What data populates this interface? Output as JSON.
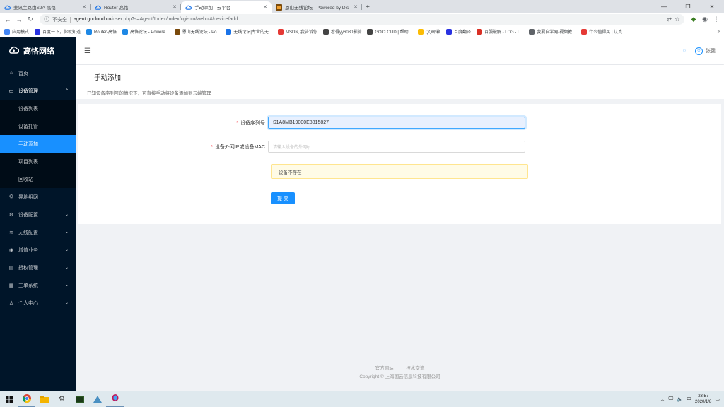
{
  "browser": {
    "tabs": [
      {
        "title": "斐讯主路由S2A-高恪",
        "active": false
      },
      {
        "title": "Router-高恪",
        "active": false
      },
      {
        "title": "手动添加 - 云平台",
        "active": true
      },
      {
        "title": "恩山无线论坛 - Powered by Dis",
        "active": false
      }
    ],
    "new_tab": "+",
    "insecure_label": "不安全",
    "url_host": "agent.gocloud.cn",
    "url_path": "/user.php?s=Agent/Index/index/cgi-bin/webui#/device/add",
    "bookmarks": [
      {
        "label": "应用模式",
        "color": "#4285f4"
      },
      {
        "label": "百度一下，你就知道",
        "color": "#2932e1"
      },
      {
        "label": "Router-高恪",
        "color": "#1e88e5"
      },
      {
        "label": "高恪论坛 - Powere...",
        "color": "#1e88e5"
      },
      {
        "label": "恩山无线论坛 - Po...",
        "color": "#7a4a0c"
      },
      {
        "label": "无线论坛|专业的无...",
        "color": "#1a73e8"
      },
      {
        "label": "MSDN, 我告诉你",
        "color": "#e53935"
      },
      {
        "label": "看得yy6080影院",
        "color": "#444444"
      },
      {
        "label": "GOCLOUD | 帮助...",
        "color": "#444444"
      },
      {
        "label": "QQ邮箱",
        "color": "#fbbc05"
      },
      {
        "label": "百度翻译",
        "color": "#2932e1"
      },
      {
        "label": "百服破解 - LCG - L...",
        "color": "#d93025"
      },
      {
        "label": "我要自学网-视频教...",
        "color": "#5f6368"
      },
      {
        "label": "什么值得买 | 认真...",
        "color": "#e53935"
      }
    ]
  },
  "sidebar": {
    "logo_text": "高恪网络",
    "items": [
      {
        "label": "首页",
        "icon": "⌂",
        "arrow": ""
      },
      {
        "label": "设备管理",
        "icon": "▭",
        "arrow": "⌃",
        "open": true
      },
      {
        "label": "异地组网",
        "icon": "⛭",
        "arrow": ""
      },
      {
        "label": "设备配置",
        "icon": "⚙",
        "arrow": "⌄"
      },
      {
        "label": "无线配置",
        "icon": "≋",
        "arrow": "⌄"
      },
      {
        "label": "增值业务",
        "icon": "◉",
        "arrow": "⌄"
      },
      {
        "label": "授权管理",
        "icon": "▤",
        "arrow": "⌄"
      },
      {
        "label": "工单系统",
        "icon": "▦",
        "arrow": "⌄"
      },
      {
        "label": "个人中心",
        "icon": "♙",
        "arrow": "⌄"
      }
    ],
    "submenu": [
      {
        "label": "设备列表",
        "active": false
      },
      {
        "label": "设备托管",
        "active": false
      },
      {
        "label": "手动添加",
        "active": true
      },
      {
        "label": "项目列表",
        "active": false
      },
      {
        "label": "回收站",
        "active": false
      }
    ]
  },
  "header": {
    "fold_icon": "☰",
    "bell_icon": "♢",
    "user_name": "张健"
  },
  "page": {
    "title": "手动添加",
    "description": "已知设备序列号的情况下，可直接手动将设备添加到云端管理"
  },
  "form": {
    "serial_label": "设备序列号",
    "serial_value": "S1A8MB19000E8815827",
    "mac_label": "设备外网IP或设备MAC",
    "mac_placeholder": "请输入设备的外网ip",
    "alert_text": "设备不存在",
    "submit_label": "提 交"
  },
  "footer": {
    "link_official": "官方网站",
    "link_support": "技术交流",
    "copyright": "Copyright © 上海国云信息科技有限公司"
  },
  "taskbar": {
    "ime": "中",
    "time": "23:57",
    "date": "2020/1/8"
  }
}
